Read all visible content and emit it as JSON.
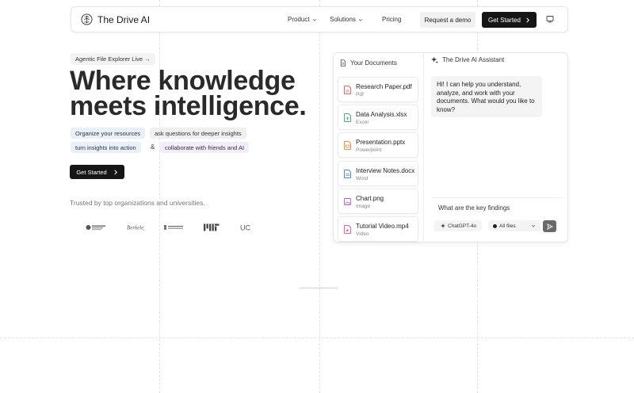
{
  "nav": {
    "brand": "The Drive AI",
    "items": [
      {
        "label": "Product"
      },
      {
        "label": "Solutions"
      },
      {
        "label": "Pricing"
      }
    ],
    "demo_label": "Request a demo",
    "cta_label": "Get Started"
  },
  "hero": {
    "badge": "Agentic File Explorer Live →",
    "title_line1": "Where knowledge",
    "title_line2": "meets intelligence.",
    "chips": [
      {
        "label": "Organize your resources",
        "color": "#e8f0fb"
      },
      {
        "label": "ask questions for deeper insights",
        "color": "#efefef"
      },
      {
        "label": "turn insights into action",
        "color": "#e8f0fb"
      },
      {
        "label": "collaborate with friends and AI",
        "color": "#f3ecfa"
      }
    ],
    "amp": "&",
    "cta_label": "Get Started",
    "trusted": "Trusted by top organizations and universities.",
    "orgs": [
      "UNIVERSITY OF ALBERTA",
      "Berkeley",
      "McGILL UNIVERSITY",
      "MIT",
      "UC"
    ]
  },
  "documents": {
    "header": "Your Documents",
    "files": [
      {
        "name": "Research Paper.pdf",
        "type": "Pdf",
        "color": "#e0524a"
      },
      {
        "name": "Data Analysis.xlsx",
        "type": "Excel",
        "color": "#3aa35a"
      },
      {
        "name": "Presentation.pptx",
        "type": "Powerpoint",
        "color": "#e8822e"
      },
      {
        "name": "Interview Notes.docx",
        "type": "Word",
        "color": "#3b78d8"
      },
      {
        "name": "Chart.png",
        "type": "Image",
        "color": "#b05ad0"
      },
      {
        "name": "Tutorial Video.mp4",
        "type": "Video",
        "color": "#d94a9e"
      }
    ]
  },
  "assistant": {
    "header": "The Drive AI Assistant",
    "message": "Hi! I can help you understand, analyze, and work with your documents. What would you like to know?",
    "input_value": "What are the key findings",
    "model": "ChatGPT-4o",
    "scope": "All files"
  }
}
